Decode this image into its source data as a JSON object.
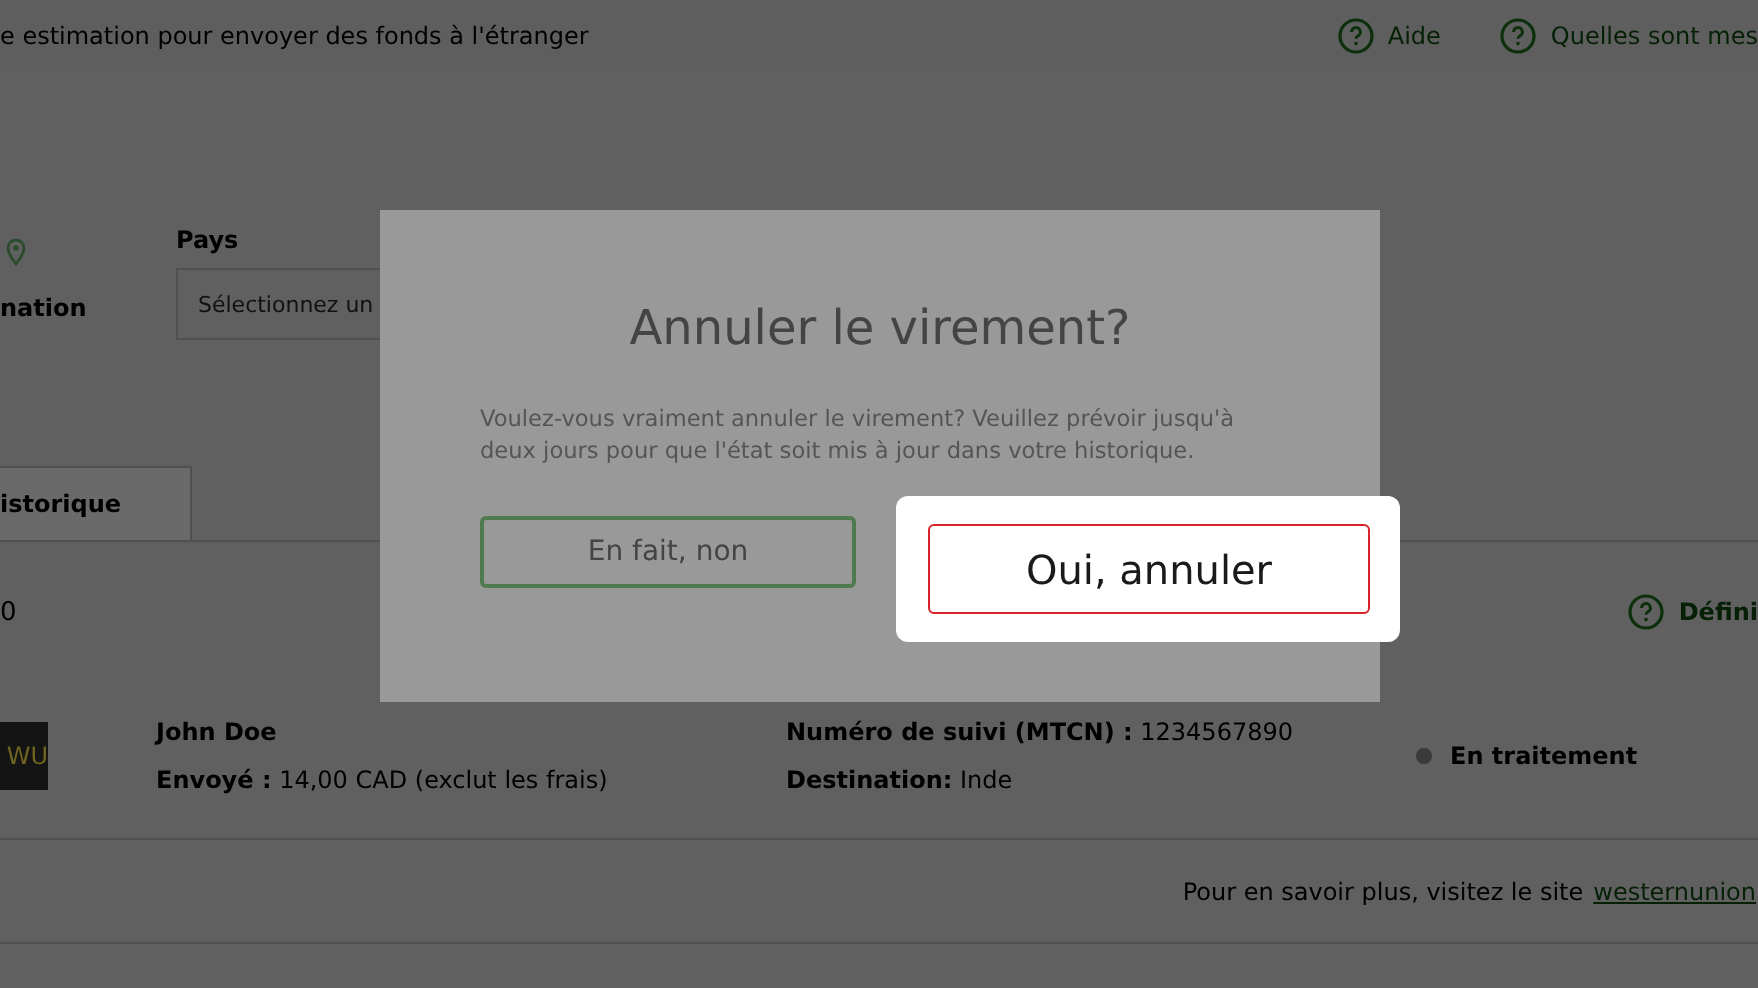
{
  "header": {
    "title": "e estimation pour envoyer des fonds à l'étranger",
    "links": [
      {
        "label": "Aide"
      },
      {
        "label": "Quelles sont mes"
      }
    ]
  },
  "form": {
    "destination_label": "nation",
    "country": {
      "label": "Pays",
      "placeholder": "Sélectionnez un"
    }
  },
  "tabs": [
    {
      "label": "istorique",
      "selected": true
    }
  ],
  "summary": {
    "count": "0",
    "help_link": "Défini"
  },
  "transfers": [
    {
      "logo": "WU",
      "name": "John Doe",
      "sent_label": "Envoyé :",
      "sent_value": "14,00 CAD (exclut les frais)",
      "tracking_label": "Numéro de suivi (MTCN) :",
      "tracking_value": "1234567890",
      "destination_label": "Destination:",
      "destination_value": "Inde",
      "status": "En traitement"
    }
  ],
  "footer_note": {
    "text": "Pour en savoir plus, visitez le site",
    "link": "westernunion"
  },
  "dialog": {
    "title": "Annuler le virement?",
    "message": "Voulez-vous vraiment annuler le virement? Veuillez prévoir jusqu'à deux jours pour que l'état soit mis à jour dans votre historique.",
    "buttons": [
      {
        "label": "En fait, non",
        "kind": "secondary",
        "highlighted": false
      },
      {
        "label": "Oui, annuler",
        "kind": "danger",
        "highlighted": true
      }
    ]
  }
}
